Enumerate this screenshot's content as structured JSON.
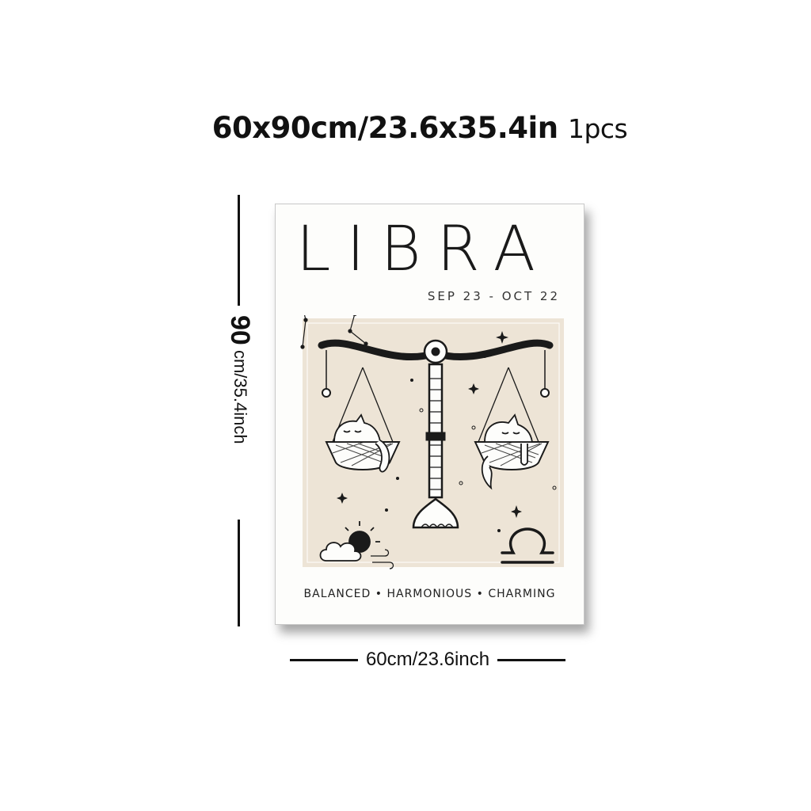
{
  "size_heading": {
    "text": "60x90cm/23.6x35.4in",
    "quantity": "1pcs"
  },
  "dimensions": {
    "height_value": "90",
    "height_unit": "cm/35.4inch",
    "width_label": "60cm/23.6inch"
  },
  "poster": {
    "title": "LIBRA",
    "dates": "SEP 23 - OCT 22",
    "traits": [
      "BALANCED",
      "HARMONIOUS",
      "CHARMING"
    ],
    "trait_separator": "•",
    "colors": {
      "paper": "#fdfdfb",
      "panel": "#ede4d6",
      "ink": "#1a1a1a"
    },
    "artwork": {
      "main": "balance-scale-with-cats",
      "decorations": [
        "libra-constellation",
        "sun-cloud-wind",
        "libra-symbol",
        "stars",
        "sparkles"
      ]
    }
  }
}
